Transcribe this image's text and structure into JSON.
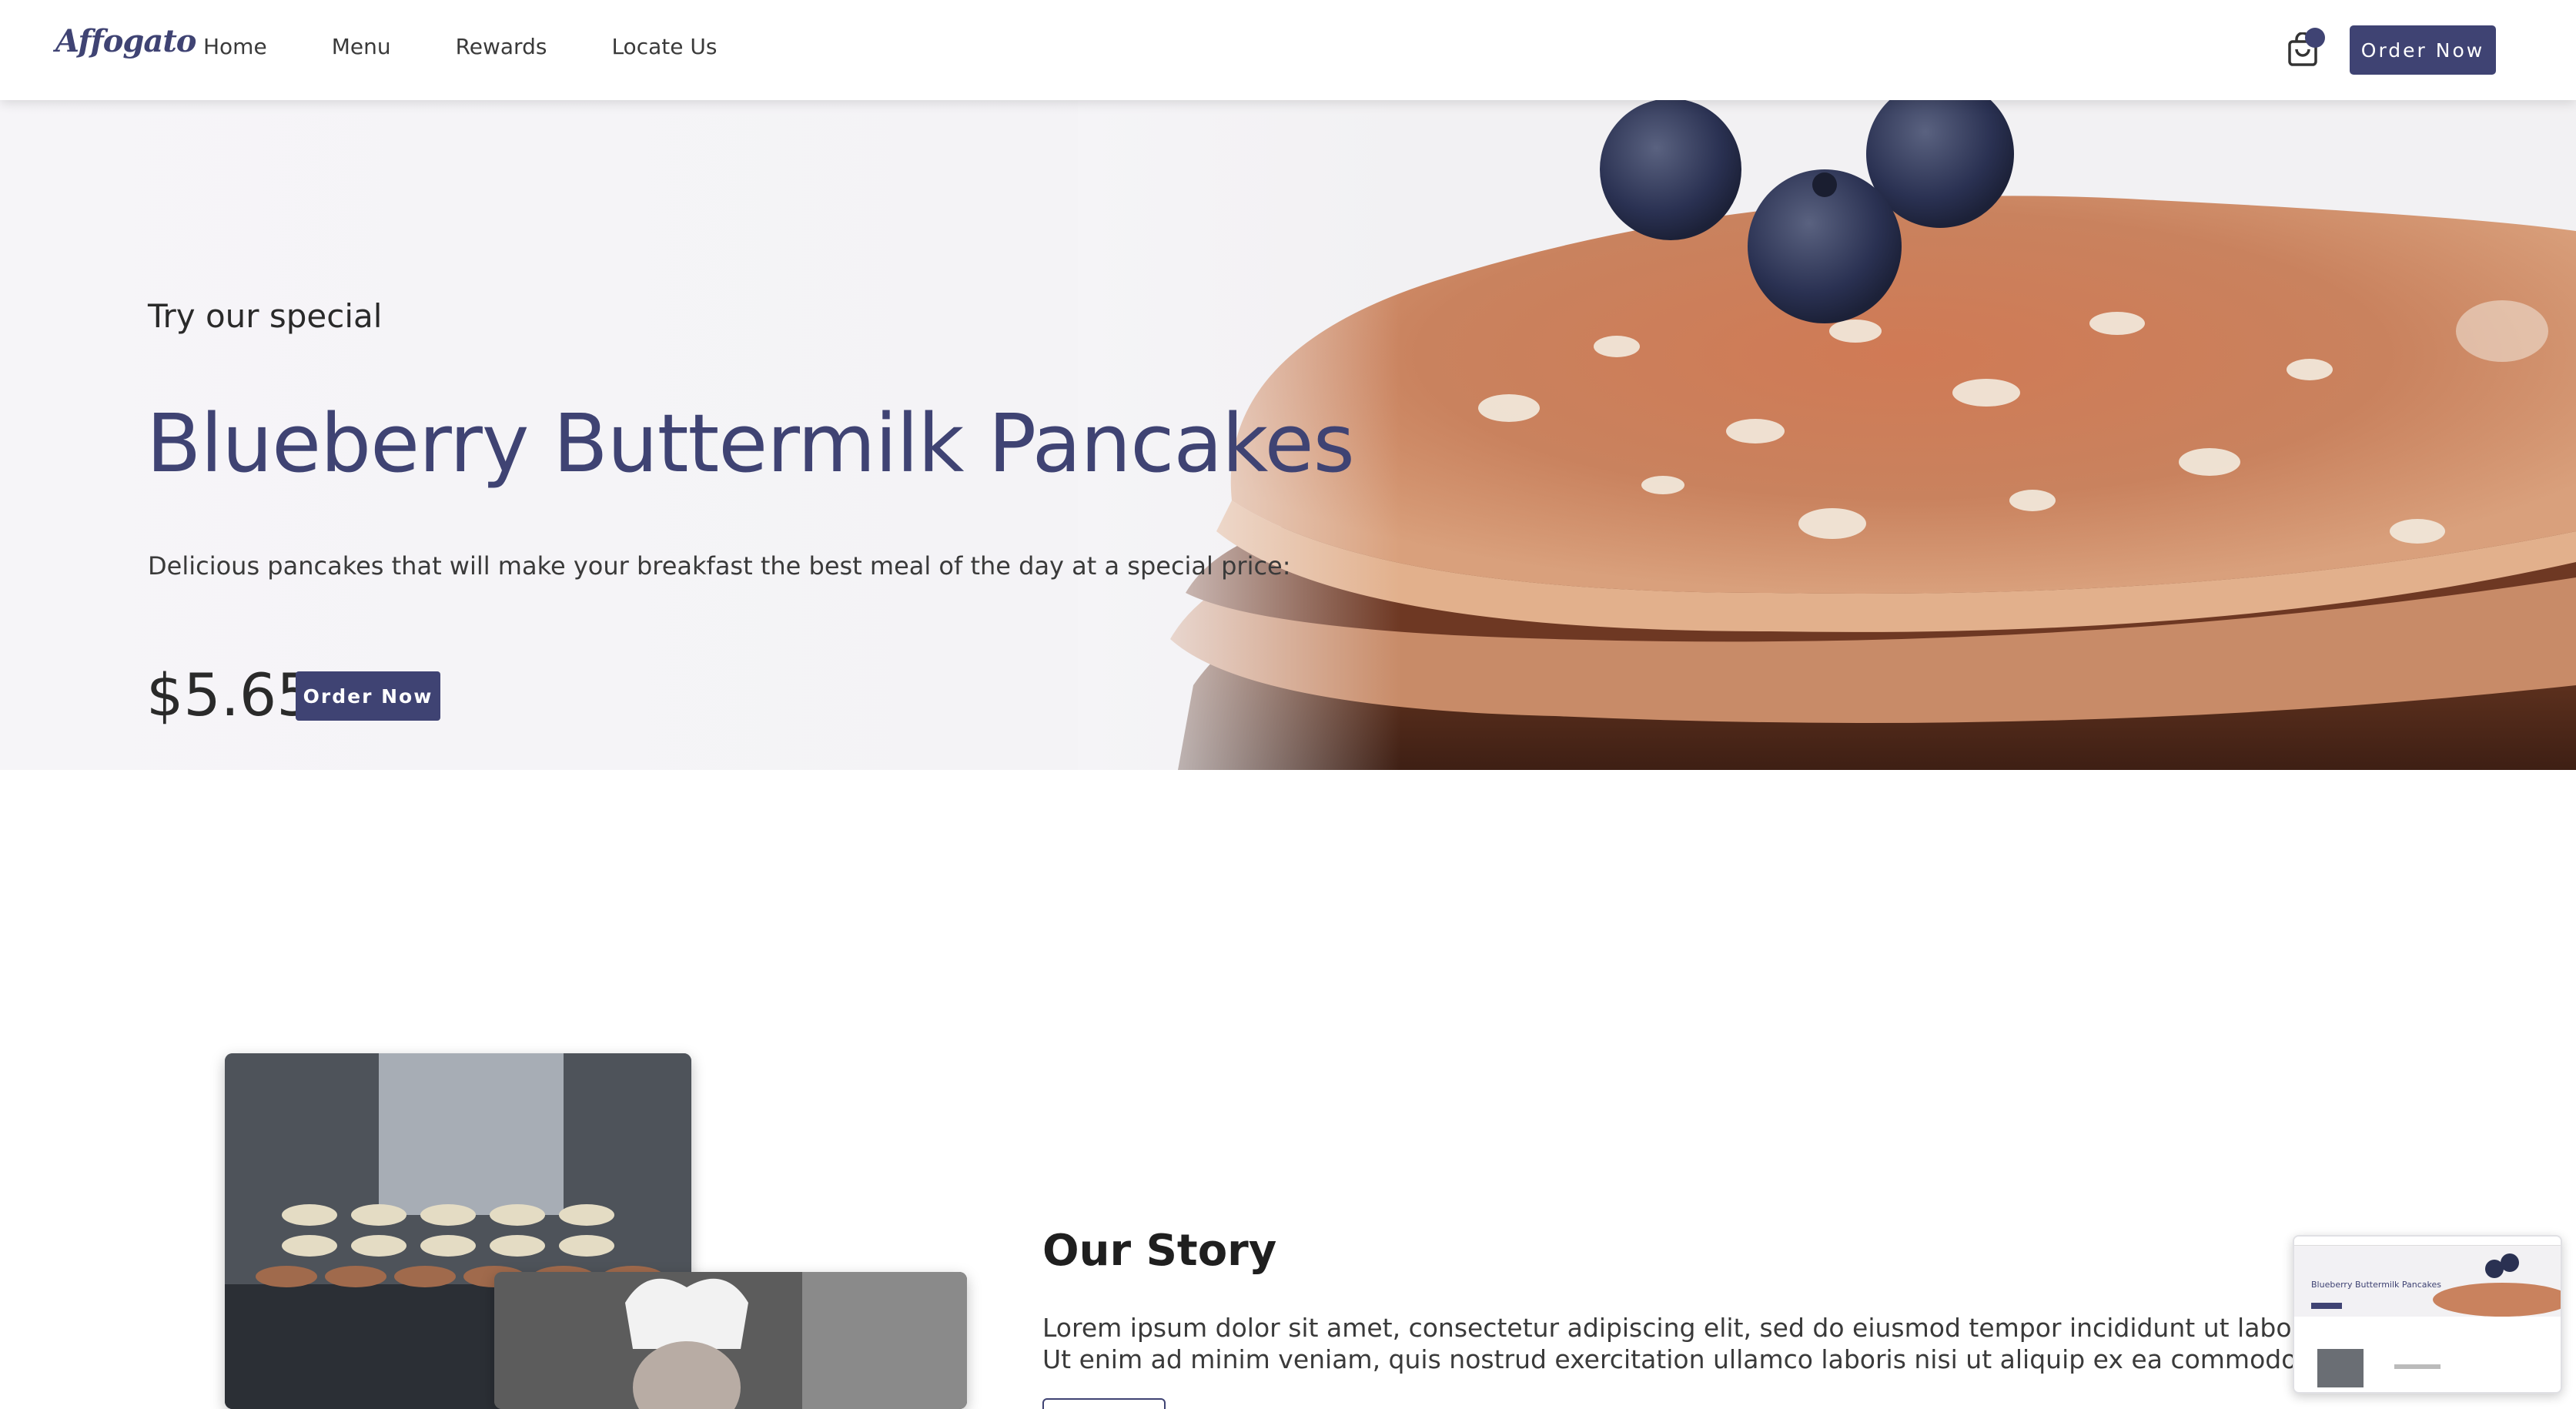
{
  "nav": {
    "logo": "Affogato",
    "links": [
      "Home",
      "Menu",
      "Rewards",
      "Locate Us"
    ],
    "order_button": "Order Now",
    "cart_icon": "shopping-bag-icon"
  },
  "hero": {
    "kicker": "Try our special",
    "title": "Blueberry Buttermilk Pancakes",
    "description": "Delicious pancakes that will make your breakfast the best meal of the day at a special price:",
    "price": "$5.65",
    "order_button": "Order Now"
  },
  "story": {
    "title": "Our Story",
    "lines": [
      "Lorem ipsum dolor sit amet, consectetur adipiscing elit, sed do eiusmod tempor incididunt ut labore et dolore mag",
      "Ut enim ad minim veniam, quis nostrud exercitation ullamco laboris nisi ut aliquip ex ea commodo consequat."
    ]
  },
  "colors": {
    "brand": "#3f4373",
    "text": "#3a3a3a"
  }
}
